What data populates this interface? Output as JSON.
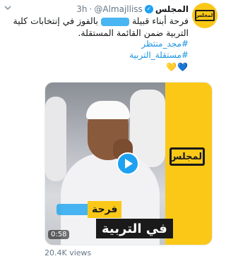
{
  "header": {
    "name": "المجلس",
    "handle": "@Almajlliss",
    "separator": "·",
    "time": "3h"
  },
  "avatar": {
    "logo_text": "المجلس",
    "color": "#fbc817"
  },
  "tweet": {
    "text_part1": "فرحة أبناء قبيلة",
    "text_part2": "بالفوز في إنتخابات كلية التربية ضمن القائمة المستقلة."
  },
  "hashtags": [
    "#مجد_منتظر",
    "#مستقلة_التربية"
  ],
  "hearts": [
    "💛",
    "💙"
  ],
  "media": {
    "logo_text": "المجلس",
    "caption_top": "فرحة",
    "caption_bottom": "في التربية",
    "duration": "0:58",
    "play_icon": "play-icon"
  },
  "footer": {
    "views": "20.4K views"
  },
  "colors": {
    "accent": "#1da1f2",
    "brand": "#fbc817",
    "redaction": "#29a8f0"
  }
}
